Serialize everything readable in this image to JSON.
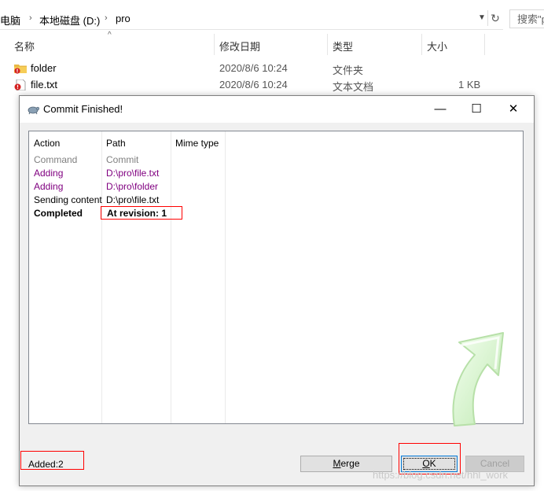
{
  "explorer": {
    "breadcrumb": [
      "电脑",
      "本地磁盘 (D:)",
      "pro"
    ],
    "search_placeholder": "搜索\"p",
    "columns": {
      "name": "名称",
      "date": "修改日期",
      "type": "类型",
      "size": "大小"
    },
    "files": [
      {
        "name": "folder",
        "date": "2020/8/6 10:24",
        "type": "文件夹",
        "size": "",
        "icon": "folder-icon"
      },
      {
        "name": "file.txt",
        "date": "2020/8/6 10:24",
        "type": "文本文档",
        "size": "1 KB",
        "icon": "text-file-icon"
      }
    ]
  },
  "dialog": {
    "title": "Commit Finished!",
    "columns": {
      "action": "Action",
      "path": "Path",
      "mime": "Mime type"
    },
    "rows": [
      {
        "action": "Command",
        "path": "Commit",
        "style": "gray"
      },
      {
        "action": "Adding",
        "path": "D:\\pro\\file.txt",
        "style": "purple"
      },
      {
        "action": "Adding",
        "path": "D:\\pro\\folder",
        "style": "purple"
      },
      {
        "action": "Sending content",
        "path": "D:\\pro\\file.txt",
        "style": "black"
      },
      {
        "action": "Completed",
        "path": "At revision: 1",
        "style": "bold"
      }
    ],
    "status": "Added:2",
    "buttons": {
      "merge": {
        "prefix": "",
        "accel": "M",
        "suffix": "erge"
      },
      "ok": {
        "prefix": "",
        "accel": "O",
        "suffix": "K"
      },
      "cancel": "Cancel"
    }
  },
  "watermark": "https://blog.csdn.net/hhl_work",
  "colors": {
    "accent": "#0078d7",
    "highlight": "#ff0000",
    "purple": "#800080"
  }
}
